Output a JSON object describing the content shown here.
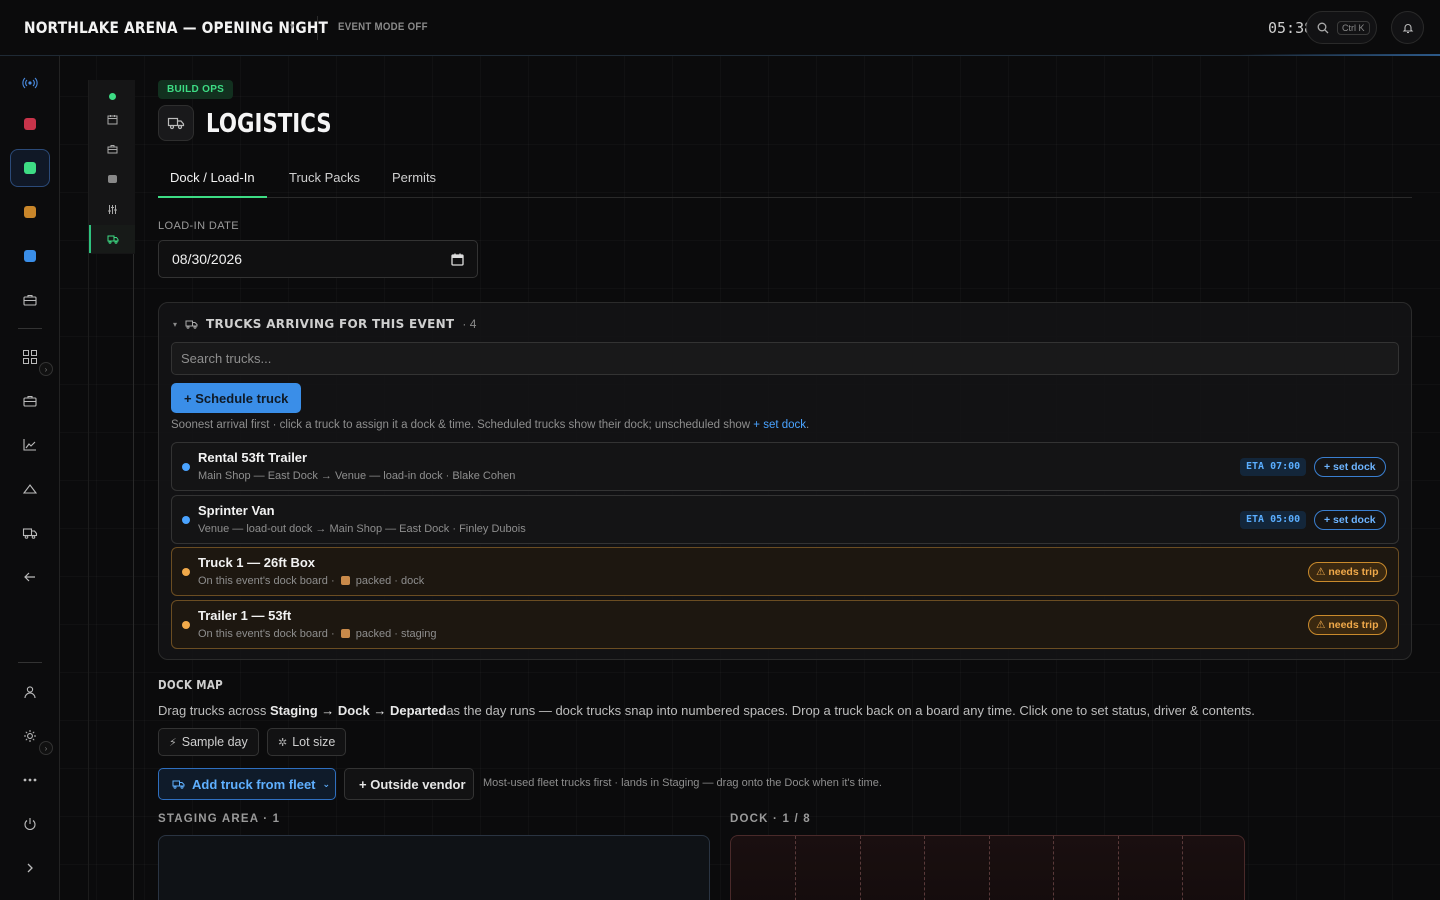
{
  "header": {
    "event_title": "NORTHLAKE ARENA — OPENING NIGHT",
    "event_mode": "EVENT MODE OFF",
    "clock": "05:38",
    "search_shortcut": "Ctrl K"
  },
  "rail": {
    "colors": [
      "#c8344a",
      "#3ddc84",
      "#c9862a",
      "#3a8ee8"
    ]
  },
  "page": {
    "badge": "BUILD OPS",
    "title": "LOGISTICS",
    "tabs": [
      {
        "label": "Dock / Load-In",
        "active": true
      },
      {
        "label": "Truck Packs",
        "active": false
      },
      {
        "label": "Permits",
        "active": false
      }
    ],
    "load_in_label": "LOAD-IN DATE",
    "load_in_date": "08/30/2026"
  },
  "trucks_panel": {
    "title": "TRUCKS ARRIVING FOR THIS EVENT",
    "count": "· 4",
    "search_placeholder": "Search trucks...",
    "schedule_button": "+ Schedule truck",
    "hint": "Soonest arrival first · click a truck to assign it a dock & time. Scheduled trucks show their dock; unscheduled show",
    "hint_link": "+ set dock",
    "hint_end": ".",
    "rows": [
      {
        "name": "Rental 53ft Trailer",
        "sub": "Main Shop — East Dock → Venue — load-in dock · Blake Cohen",
        "eta": "ETA 07:00",
        "action": "+ set dock",
        "status": "scheduled"
      },
      {
        "name": "Sprinter Van",
        "sub": "Venue — load-out dock → Main Shop — East Dock · Finley Dubois",
        "eta": "ETA 05:00",
        "action": "+ set dock",
        "status": "scheduled"
      },
      {
        "name": "Truck 1 — 26ft Box",
        "sub_prefix": "On this event's dock board ·",
        "sub_suffix": "packed · dock",
        "action": "⚠ needs trip",
        "status": "warn"
      },
      {
        "name": "Trailer 1 — 53ft",
        "sub_prefix": "On this event's dock board ·",
        "sub_suffix": "packed · staging",
        "action": "⚠ needs trip",
        "status": "warn"
      }
    ]
  },
  "dock_map": {
    "title": "DOCK MAP",
    "desc_prefix": "Drag trucks across",
    "desc_staging": "Staging",
    "desc_arrow1": "→",
    "desc_dock": "Dock",
    "desc_arrow2": "→",
    "desc_departed": "Departed",
    "desc_suffix": "as the day runs — dock trucks snap into numbered spaces. Drop a truck back on a board any time. Click one to set status, driver & contents.",
    "sample_day": "Sample day",
    "lot_size": "Lot size",
    "add_fleet": "Add truck from fleet",
    "outside_vendor": "+ Outside vendor",
    "fleet_note": "Most-used fleet trucks first · lands in Staging — drag onto the Dock when it's time.",
    "staging_label": "STAGING AREA · 1",
    "dock_label": "DOCK · 1 / 8"
  }
}
